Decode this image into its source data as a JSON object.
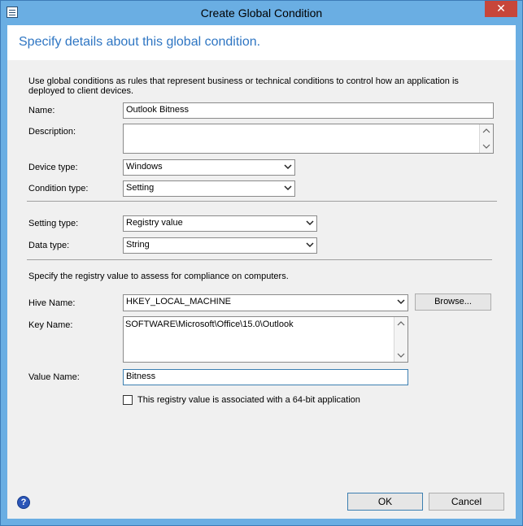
{
  "window": {
    "title": "Create Global Condition",
    "close": "✕"
  },
  "header": {
    "title": "Specify details about this global condition."
  },
  "intro": "Use global conditions as rules that represent business or technical conditions to control how an application is deployed to client devices.",
  "fields": {
    "name": {
      "label": "Name:",
      "value": "Outlook Bitness"
    },
    "description": {
      "label": "Description:",
      "value": ""
    },
    "device_type": {
      "label": "Device type:",
      "value": "Windows"
    },
    "condition_type": {
      "label": "Condition type:",
      "value": "Setting"
    },
    "setting_type": {
      "label": "Setting type:",
      "value": "Registry value"
    },
    "data_type": {
      "label": "Data type:",
      "value": "String"
    }
  },
  "registry": {
    "intro": "Specify the registry value to assess for compliance on computers.",
    "hive": {
      "label": "Hive Name:",
      "value": "HKEY_LOCAL_MACHINE"
    },
    "browse": "Browse...",
    "key": {
      "label": "Key Name:",
      "value": "SOFTWARE\\Microsoft\\Office\\15.0\\Outlook"
    },
    "value_name": {
      "label": "Value Name:",
      "value": "Bitness"
    },
    "bit64": {
      "label": "This registry value is associated with a 64-bit application",
      "checked": false
    }
  },
  "buttons": {
    "ok": "OK",
    "cancel": "Cancel",
    "help": "?"
  },
  "colors": {
    "titlebar": "#6aaee3",
    "header_text": "#2f76c3",
    "close": "#c7463a"
  }
}
